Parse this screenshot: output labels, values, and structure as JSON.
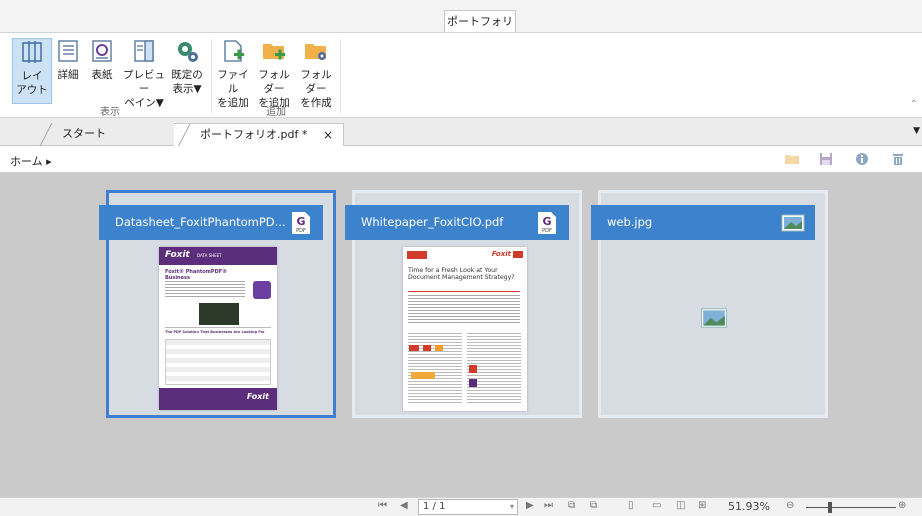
{
  "ribbon": {
    "context_tab": "ポートフォリオ",
    "buttons": [
      {
        "l1": "レイ",
        "l2": "アウト"
      },
      {
        "l1": "詳細",
        "l2": ""
      },
      {
        "l1": "表紙",
        "l2": ""
      },
      {
        "l1": "プレビュー",
        "l2": "ペイン▼"
      },
      {
        "l1": "既定の",
        "l2": "表示▼"
      },
      {
        "l1": "ファイル",
        "l2": "を追加"
      },
      {
        "l1": "フォルダー",
        "l2": "を追加"
      },
      {
        "l1": "フォルダー",
        "l2": "を作成"
      }
    ],
    "groups": {
      "view": "表示",
      "add": "追加"
    }
  },
  "tabs": [
    {
      "label": "スタート"
    },
    {
      "label": "ポートフォリオ.pdf *",
      "close": "×"
    }
  ],
  "breadcrumb": {
    "home": "ホーム ▸"
  },
  "cards": [
    {
      "title": "Datasheet_FoxitPhantomPD...",
      "icon": "pdf-icon",
      "icon_text": "PDF",
      "selected": true
    },
    {
      "title": "Whitepaper_FoxitCIO.pdf",
      "icon": "pdf-icon",
      "icon_text": "PDF",
      "selected": false
    },
    {
      "title": "web.jpg",
      "icon": "image-icon",
      "selected": false
    }
  ],
  "thumb1": {
    "brand": "Foxit",
    "tag": "DATA SHEET",
    "heading": "Foxit® PhantomPDF® Business",
    "subheading": "The PDF Solution That Businesses Are Looking For"
  },
  "thumb2": {
    "brand": "Foxit",
    "title": "Time for a Fresh Look at Your Document Management Strategy?"
  },
  "status": {
    "page": "1 / 1",
    "zoom": "51.93%"
  },
  "colors": {
    "accent": "#3d82cc",
    "folder": "#f0b14a",
    "purple": "#5c2d7a"
  }
}
